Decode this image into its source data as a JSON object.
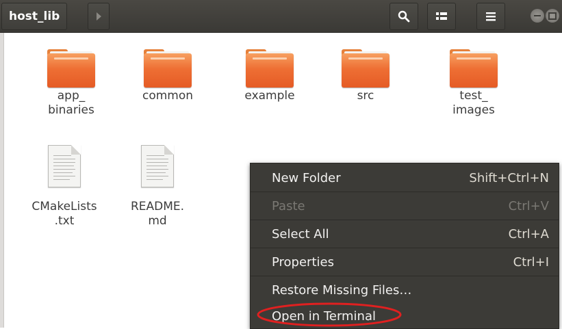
{
  "header": {
    "path_label": "host_lib"
  },
  "files": [
    {
      "type": "folder",
      "name_lines": [
        "app_",
        "binaries"
      ]
    },
    {
      "type": "folder",
      "name_lines": [
        "common"
      ]
    },
    {
      "type": "folder",
      "name_lines": [
        "example"
      ]
    },
    {
      "type": "folder",
      "name_lines": [
        "src"
      ]
    },
    {
      "type": "folder",
      "name_lines": [
        "test_",
        "images"
      ]
    },
    {
      "type": "text-file",
      "name_lines": [
        "CMakeLists",
        ".txt"
      ]
    },
    {
      "type": "text-file",
      "name_lines": [
        "README.",
        "md"
      ]
    }
  ],
  "context_menu": {
    "items": [
      {
        "label": "New Folder",
        "shortcut": "Shift+Ctrl+N",
        "enabled": true
      },
      {
        "label": "Paste",
        "shortcut": "Ctrl+V",
        "enabled": false
      },
      {
        "label": "Select All",
        "shortcut": "Ctrl+A",
        "enabled": true
      },
      {
        "label": "Properties",
        "shortcut": "Ctrl+I",
        "enabled": true
      },
      {
        "label": "Restore Missing Files…",
        "shortcut": "",
        "enabled": true
      },
      {
        "label": "Open in Terminal",
        "shortcut": "",
        "enabled": true
      }
    ]
  },
  "colors": {
    "folder_orange": "#ee6f34",
    "menu_background": "#3c3b37",
    "annotation_red": "#e02020"
  },
  "icons": [
    "search-icon",
    "grid-view-icon",
    "hamburger-menu-icon",
    "minimize-icon",
    "maximize-icon"
  ]
}
